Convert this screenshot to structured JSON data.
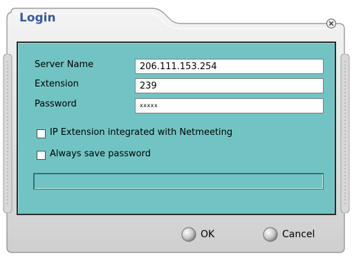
{
  "window": {
    "title": "Login",
    "close_icon": "close-icon"
  },
  "form": {
    "server_name_label": "Server Name",
    "server_name_value": "206.111.153.254",
    "extension_label": "Extension",
    "extension_value": "239",
    "password_label": "Password",
    "password_value": "xxxxx"
  },
  "options": {
    "netmeeting_label": "IP Extension integrated with Netmeeting",
    "netmeeting_checked": false,
    "save_password_label": "Always save password",
    "save_password_checked": false
  },
  "status": {
    "progress": 0
  },
  "buttons": {
    "ok_label": "OK",
    "cancel_label": "Cancel"
  },
  "colors": {
    "panel": "#72c4c4",
    "title": "#3a5a9a",
    "frame": "#d4d4d4"
  }
}
